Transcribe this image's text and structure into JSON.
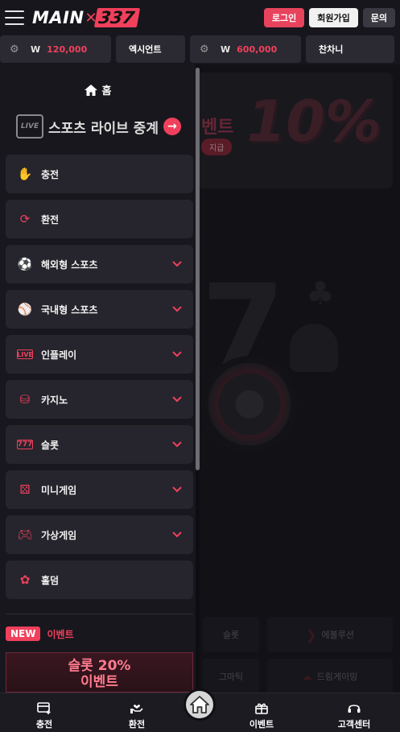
{
  "header": {
    "logo_main": "MAIN",
    "logo_num": "337",
    "login": "로그인",
    "signup": "회원가입",
    "inquiry": "문의"
  },
  "ticker": [
    {
      "currency": "W",
      "amount": "120,000"
    },
    {
      "name": "엑시언트"
    },
    {
      "currency": "W",
      "amount": "600,000"
    },
    {
      "name": "찬차니"
    }
  ],
  "background": {
    "banner_event": "벤트",
    "banner_pill": "지급",
    "banner_pct": "10%",
    "games": [
      "슬롯",
      "에볼루션",
      "그마틱",
      "드림게이밍"
    ]
  },
  "drawer": {
    "home": "홈",
    "live_badge": "LIVE",
    "live_label": "스포츠 라이브 중계",
    "menu": [
      {
        "label": "충전",
        "icon": "deposit-hand-icon",
        "expandable": false
      },
      {
        "label": "환전",
        "icon": "exchange-coin-icon",
        "expandable": false
      },
      {
        "label": "해외형 스포츠",
        "icon": "sports-balls-icon",
        "expandable": true
      },
      {
        "label": "국내형 스포츠",
        "icon": "sports-balls-icon",
        "expandable": true
      },
      {
        "label": "인플레이",
        "icon": "live-icon",
        "expandable": true
      },
      {
        "label": "카지노",
        "icon": "chips-icon",
        "expandable": true
      },
      {
        "label": "슬롯",
        "icon": "slot-machine-icon",
        "expandable": true
      },
      {
        "label": "미니게임",
        "icon": "dice-icon",
        "expandable": true
      },
      {
        "label": "가상게임",
        "icon": "gamepad-icon",
        "expandable": true
      },
      {
        "label": "홀덤",
        "icon": "poker-chip-icon",
        "expandable": false
      }
    ],
    "new_badge": "NEW",
    "events_label": "이벤트",
    "event_card_line1": "슬롯 20%",
    "event_card_line2": "이벤트"
  },
  "bottom_nav": [
    {
      "label": "충전",
      "icon": "card-plus-icon"
    },
    {
      "label": "환전",
      "icon": "hand-heart-icon"
    },
    {
      "label": "이벤트",
      "icon": "gift-icon"
    },
    {
      "label": "고객센터",
      "icon": "headset-icon"
    }
  ],
  "colors": {
    "accent": "#f0405c",
    "panel": "#26252d",
    "background": "#1c1b22"
  }
}
